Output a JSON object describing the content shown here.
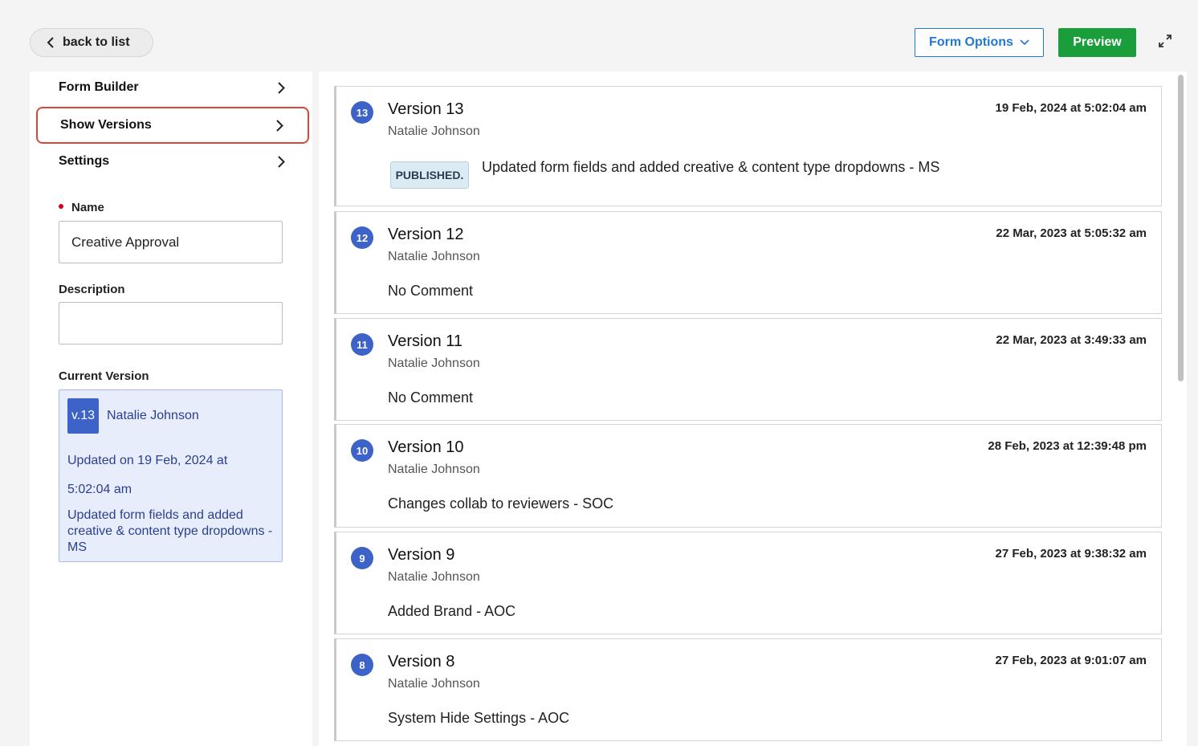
{
  "topbar": {
    "back_label": "back to list",
    "form_options_label": "Form Options",
    "preview_label": "Preview"
  },
  "sidebar": {
    "nav": [
      {
        "label": "Form Builder"
      },
      {
        "label": "Show Versions",
        "active": true
      },
      {
        "label": "Settings"
      }
    ],
    "name_label": "Name",
    "name_value": "Creative Approval",
    "description_label": "Description",
    "description_value": "",
    "current_version_label": "Current Version",
    "current": {
      "badge": "v.13",
      "author": "Natalie Johnson",
      "updated": "Updated on 19 Feb, 2024 at 5:02:04 am",
      "comment": "Updated form fields and added creative & content type dropdowns - MS"
    }
  },
  "versions": [
    {
      "num": "13",
      "title": "Version 13",
      "author": "Natalie Johnson",
      "date": "19 Feb, 2024 at 5:02:04 am",
      "badge": "PUBLISHED.",
      "comment": "Updated form fields and added creative & content type dropdowns - MS"
    },
    {
      "num": "12",
      "title": "Version 12",
      "author": "Natalie Johnson",
      "date": "22 Mar, 2023 at 5:05:32 am",
      "comment": "No Comment"
    },
    {
      "num": "11",
      "title": "Version 11",
      "author": "Natalie Johnson",
      "date": "22 Mar, 2023 at 3:49:33 am",
      "comment": "No Comment"
    },
    {
      "num": "10",
      "title": "Version 10",
      "author": "Natalie Johnson",
      "date": "28 Feb, 2023 at 12:39:48 pm",
      "comment": "Changes collab to reviewers - SOC"
    },
    {
      "num": "9",
      "title": "Version 9",
      "author": "Natalie Johnson",
      "date": "27 Feb, 2023 at 9:38:32 am",
      "comment": "Added Brand - AOC"
    },
    {
      "num": "8",
      "title": "Version 8",
      "author": "Natalie Johnson",
      "date": "27 Feb, 2023 at 9:01:07 am",
      "comment": "System Hide Settings - AOC"
    }
  ],
  "colors": {
    "accent_blue": "#1f78d1",
    "preview_green": "#1a9e3c",
    "version_badge": "#3e63c8",
    "active_outline": "#d9473a"
  },
  "icons": [
    "chevron-left-icon",
    "chevron-down-icon",
    "expand-icon",
    "chevron-right-icon"
  ]
}
